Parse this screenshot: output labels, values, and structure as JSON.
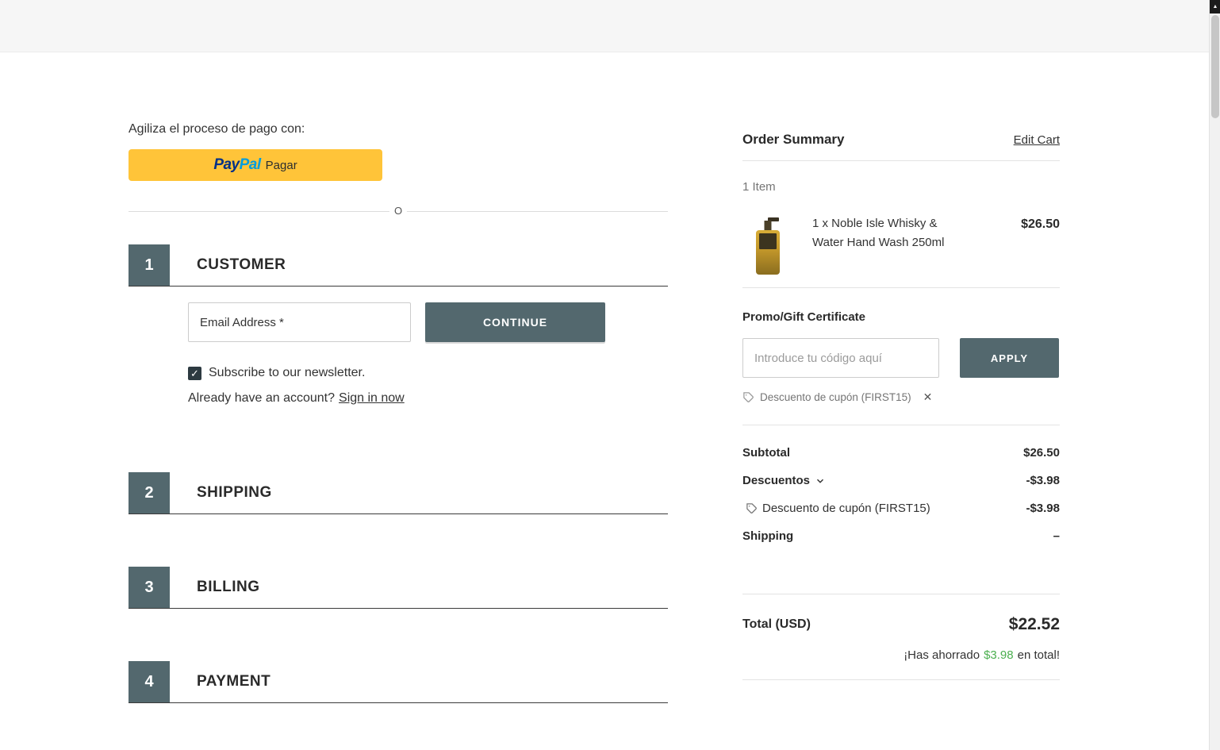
{
  "theme": {
    "accent": "#53686e",
    "paypal_yellow": "#ffc439",
    "paypal_blue_dark": "#003087",
    "paypal_blue_light": "#009cde",
    "checkbox_dark": "#2d3a41",
    "savings_green": "#4caf50"
  },
  "checkout": {
    "express_label": "Agiliza el proceso de pago con:",
    "paypal": {
      "brand_pay": "Pay",
      "brand_pal": "Pal",
      "label": "Pagar"
    },
    "divider_label": "O",
    "steps": [
      {
        "number": "1",
        "title": "CUSTOMER"
      },
      {
        "number": "2",
        "title": "SHIPPING"
      },
      {
        "number": "3",
        "title": "BILLING"
      },
      {
        "number": "4",
        "title": "PAYMENT"
      }
    ],
    "customer": {
      "email_placeholder": "Email Address *",
      "continue_label": "CONTINUE",
      "newsletter_label": "Subscribe to our newsletter.",
      "newsletter_checked_glyph": "✓",
      "signin_prompt": "Already have an account?",
      "signin_link": "Sign in now"
    }
  },
  "summary": {
    "title": "Order Summary",
    "edit_cart": "Edit Cart",
    "item_count": "1 Item",
    "items": [
      {
        "name": "1 x Noble Isle Whisky & Water Hand Wash 250ml",
        "price": "$26.50"
      }
    ],
    "promo": {
      "title": "Promo/Gift Certificate",
      "placeholder": "Introduce tu código aquí",
      "apply_label": "APPLY",
      "applied_coupon": "Descuento de cupón (FIRST15)",
      "remove_glyph": "✕"
    },
    "totals": {
      "subtotal_label": "Subtotal",
      "subtotal_value": "$26.50",
      "discounts_label": "Descuentos",
      "discounts_value": "-$3.98",
      "coupon_label": "Descuento de cupón (FIRST15)",
      "coupon_value": "-$3.98",
      "shipping_label": "Shipping",
      "shipping_value": "–",
      "total_label": "Total (USD)",
      "total_value": "$22.52",
      "savings_prefix": "¡Has ahorrado",
      "savings_amount": "$3.98",
      "savings_suffix": "en total!"
    }
  },
  "scrollbar": {
    "up_glyph": "▲"
  }
}
